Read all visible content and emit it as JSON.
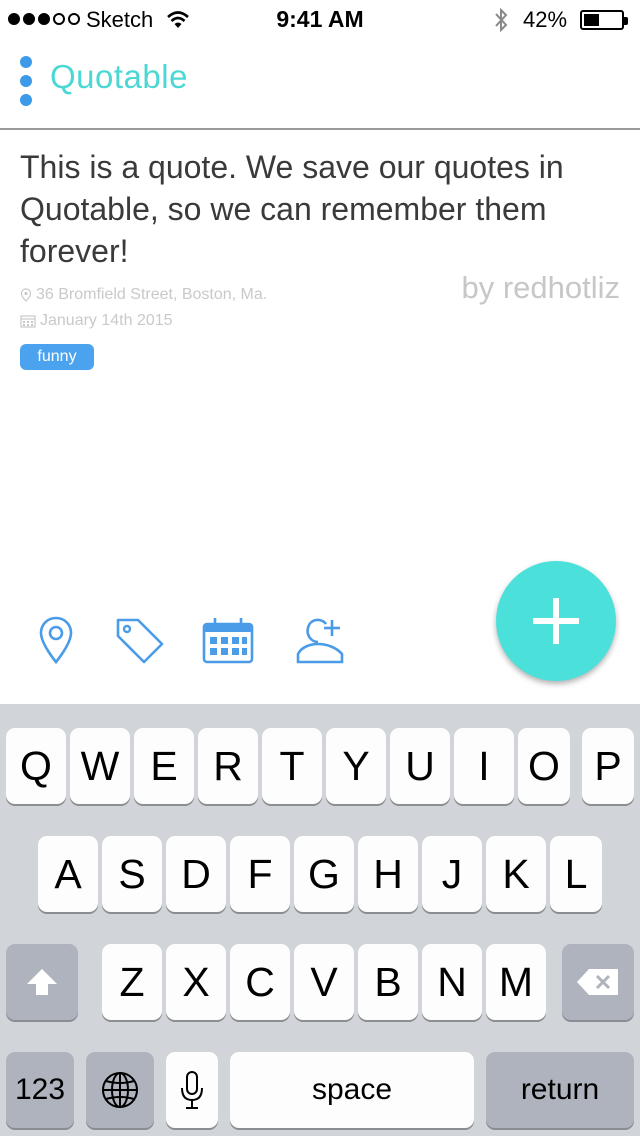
{
  "status_bar": {
    "carrier": "Sketch",
    "time": "9:41 AM",
    "battery_percent": "42%",
    "battery_level": 0.42,
    "signal_bars_filled": 3,
    "signal_bars_total": 5
  },
  "app": {
    "title": "Quotable",
    "accent_color": "#4bd8d4",
    "primary_color": "#3d9ae8"
  },
  "quote": {
    "text": "This is a quote. We save our quotes in Quotable, so we can remember them forever!",
    "author": "by redhotliz",
    "location": "36 Bromfield Street, Boston, Ma.",
    "date": "January 14th 2015",
    "tag": "funny"
  },
  "toolbar": {
    "items": [
      "location-icon",
      "tag-icon",
      "calendar-icon",
      "add-person-icon"
    ],
    "fab_icon": "plus-icon"
  },
  "keyboard": {
    "row1": [
      "Q",
      "W",
      "E",
      "R",
      "T",
      "Y",
      "U",
      "I",
      "O",
      "P"
    ],
    "row2": [
      "A",
      "S",
      "D",
      "F",
      "G",
      "H",
      "J",
      "K",
      "L"
    ],
    "row3": [
      "Z",
      "X",
      "C",
      "V",
      "B",
      "N",
      "M"
    ],
    "numbers_label": "123",
    "space_label": "space",
    "return_label": "return"
  }
}
